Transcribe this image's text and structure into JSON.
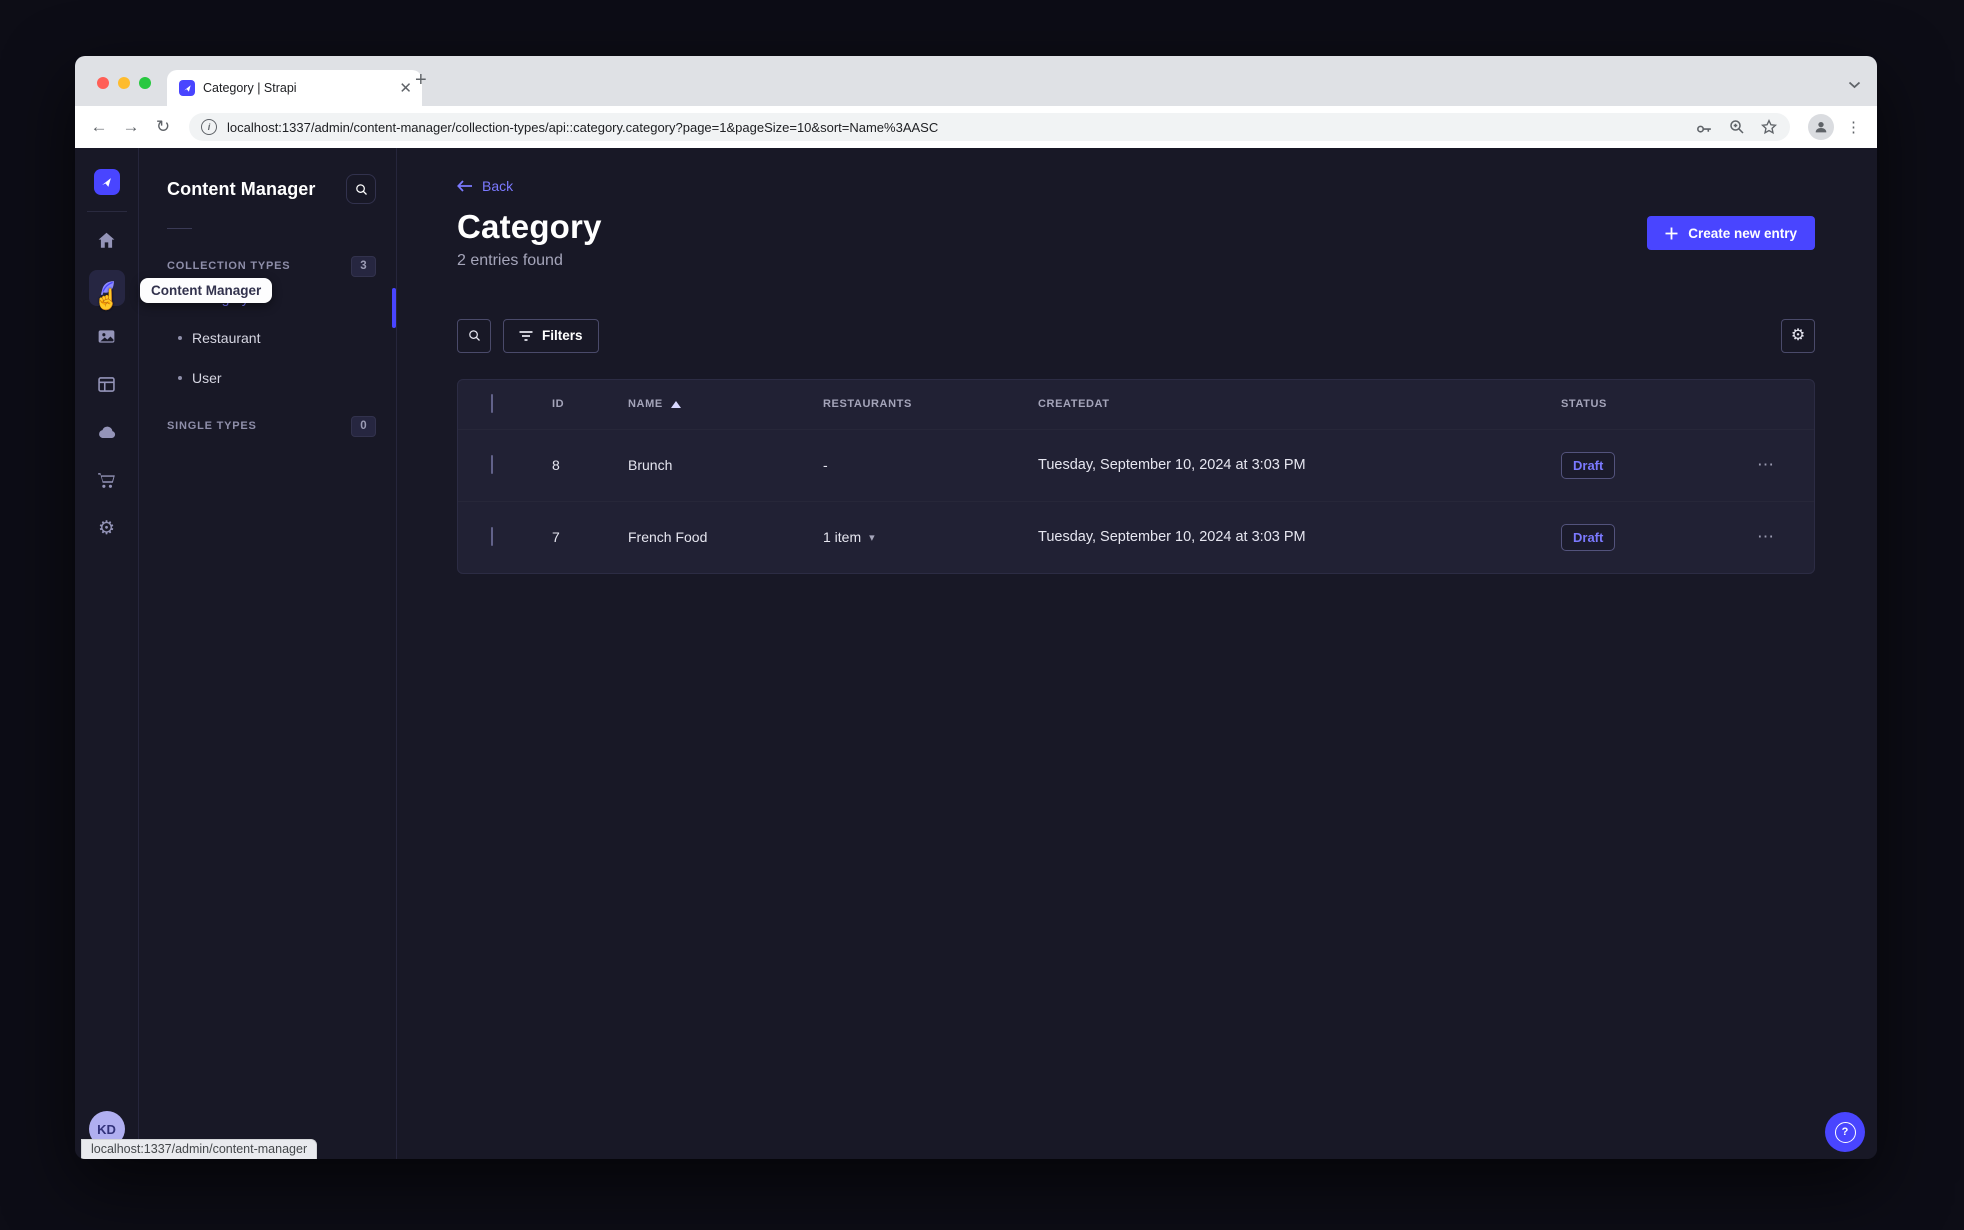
{
  "browser": {
    "tab_title": "Category | Strapi",
    "url": "localhost:1337/admin/content-manager/collection-types/api::category.category?page=1&pageSize=10&sort=Name%3AASC",
    "status_bar_url": "localhost:1337/admin/content-manager"
  },
  "colors": {
    "primary": "#4945ff",
    "primary_light": "#7b79ff",
    "app_background": "#181826",
    "surface": "#212134"
  },
  "nav_tooltip": "Content Manager",
  "subnav": {
    "title": "Content Manager",
    "sections": [
      {
        "label": "COLLECTION TYPES",
        "count": "3"
      },
      {
        "label": "SINGLE TYPES",
        "count": "0"
      }
    ],
    "items": [
      {
        "label": "Category",
        "active": true
      },
      {
        "label": "Restaurant",
        "active": false
      },
      {
        "label": "User",
        "active": false
      }
    ]
  },
  "page": {
    "back": "Back",
    "title": "Category",
    "subtitle": "2 entries found",
    "create_button": "Create new entry",
    "filters_button": "Filters"
  },
  "table": {
    "headers": {
      "id": "ID",
      "name": "NAME",
      "restaurants": "RESTAURANTS",
      "createdat": "CREATEDAT",
      "status": "STATUS"
    },
    "sorted_by": "NAME ascending",
    "rows": [
      {
        "id": "8",
        "name": "Brunch",
        "restaurants": "-",
        "createdat": "Tuesday, September 10, 2024 at 3:03 PM",
        "status": "Draft"
      },
      {
        "id": "7",
        "name": "French Food",
        "restaurants": "1 item",
        "createdat": "Tuesday, September 10, 2024 at 3:03 PM",
        "status": "Draft"
      }
    ]
  },
  "user": {
    "initials": "KD"
  },
  "icons": [
    "strapi-logo",
    "home-icon",
    "content-manager-icon",
    "media-library-icon",
    "content-type-builder-icon",
    "cloud-icon",
    "marketplace-cart-icon",
    "settings-gear-icon",
    "search-icon",
    "filter-icon",
    "sort-asc-icon",
    "row-actions-icon",
    "help-icon",
    "back-arrow-icon",
    "browser-back-icon",
    "browser-forward-icon",
    "browser-reload-icon",
    "site-info-icon",
    "password-key-icon",
    "zoom-icon",
    "bookmark-star-icon",
    "profile-icon",
    "browser-menu-icon",
    "tab-close-icon",
    "new-tab-icon",
    "tab-strip-chevron-icon",
    "hand-cursor-icon"
  ]
}
